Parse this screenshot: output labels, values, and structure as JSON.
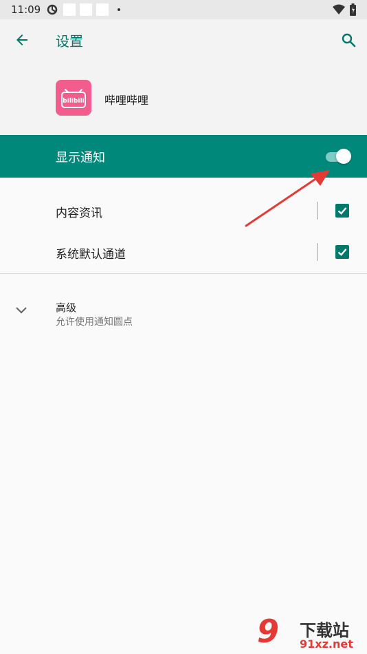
{
  "status_bar": {
    "time": "11:09"
  },
  "app_bar": {
    "title": "设置"
  },
  "app": {
    "name": "哔哩哔哩",
    "icon_text": "bilibili"
  },
  "main_toggle": {
    "label": "显示通知",
    "enabled": true
  },
  "channels": [
    {
      "label": "内容资讯",
      "checked": true
    },
    {
      "label": "系统默认通道",
      "checked": true
    }
  ],
  "advanced": {
    "title": "高级",
    "subtitle": "允许使用通知圆点"
  },
  "watermark": {
    "brand": "9",
    "text": "下载站",
    "domain": "91xz.net"
  },
  "colors": {
    "accent": "#00897b",
    "accent_dark": "#00796b",
    "app_icon": "#f25d8e",
    "arrow": "#e53935"
  }
}
